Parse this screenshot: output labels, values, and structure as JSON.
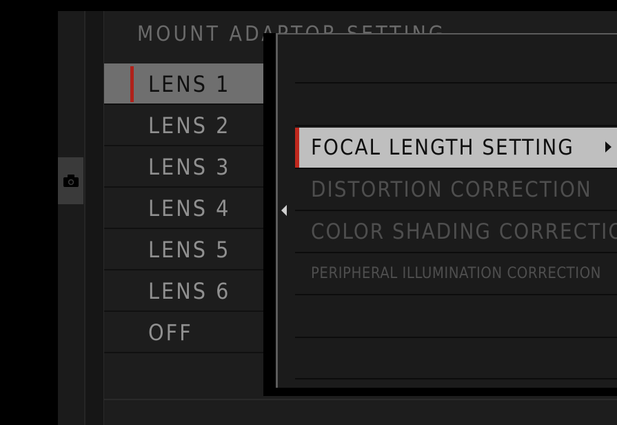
{
  "screen": {
    "title": "MOUNT ADAPTOR SETTING",
    "category_icon": "camera-icon"
  },
  "lens_menu": {
    "items": [
      {
        "label": "LENS 1",
        "selected": true
      },
      {
        "label": "LENS 2",
        "selected": false
      },
      {
        "label": "LENS 3",
        "selected": false
      },
      {
        "label": "LENS 4",
        "selected": false
      },
      {
        "label": "LENS 5",
        "selected": false
      },
      {
        "label": "LENS 6",
        "selected": false
      },
      {
        "label": "OFF",
        "selected": false
      }
    ]
  },
  "submenu": {
    "items": [
      {
        "label": "FOCAL LENGTH SETTING",
        "selected": true,
        "has_submenu": true,
        "icon": "chevron-right-icon"
      },
      {
        "label": "DISTORTION CORRECTION",
        "selected": false
      },
      {
        "label": "COLOR SHADING CORRECTION",
        "selected": false
      },
      {
        "label": "PERIPHERAL ILLUMINATION CORRECTION",
        "selected": false
      }
    ],
    "back_icon": "chevron-left-icon"
  },
  "colors": {
    "accent_red": "#c0281d",
    "selected_bg": "#bfbfbf",
    "background": "#1d1d1d"
  }
}
